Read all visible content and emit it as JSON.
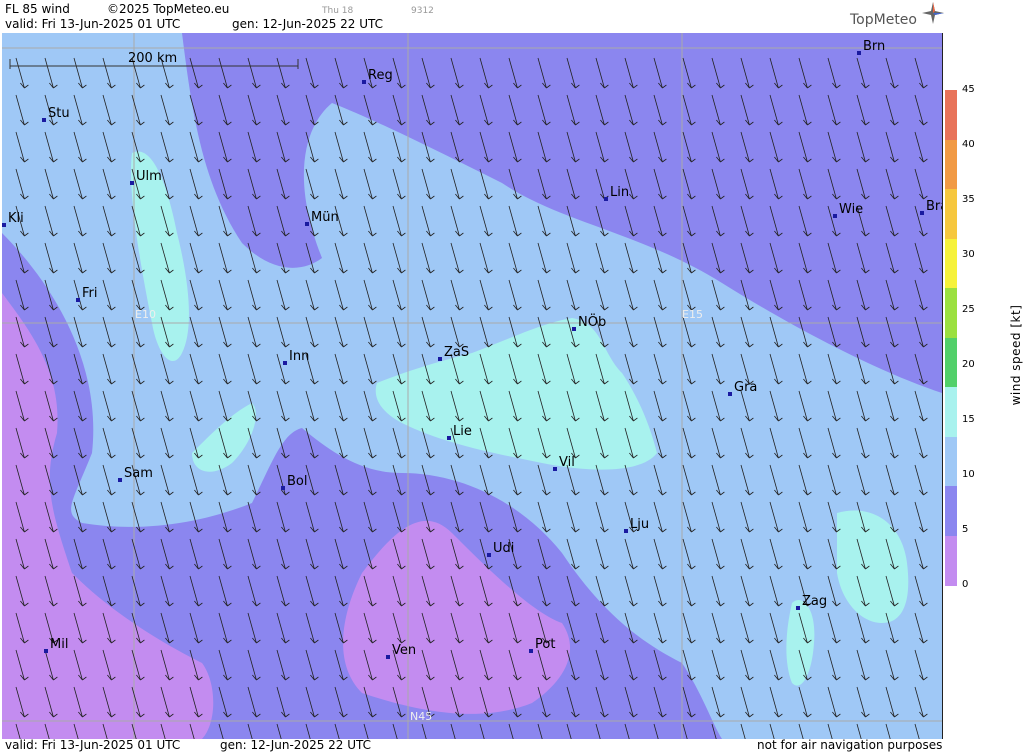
{
  "header": {
    "product": "FL 85 wind",
    "copyright": "©2025 TopMeteo.eu",
    "small_day": "Thu 18",
    "small_code": "9312",
    "valid": "valid:  Fri  13-Jun-2025  01 UTC",
    "gen": "gen: 12-Jun-2025 22 UTC",
    "brand": "TopMeteo"
  },
  "footer": {
    "valid": "valid:  Fri  13-Jun-2025  01 UTC",
    "gen": "gen: 12-Jun-2025 22 UTC",
    "disclaimer": "not for air navigation purposes"
  },
  "scale_bar": {
    "label": "200 km"
  },
  "grid_labels": {
    "e10": "E10",
    "e15": "E15",
    "n45": "N45"
  },
  "legend": {
    "label": "wind  speed  [kt]",
    "ticks": [
      "45",
      "40",
      "35",
      "30",
      "25",
      "20",
      "15",
      "10",
      "5",
      "0"
    ],
    "colors": [
      "#e8735a",
      "#f19a45",
      "#f6c73e",
      "#f6f23a",
      "#9be040",
      "#52d06a",
      "#a8f2ee",
      "#9fc8f6",
      "#8b86ef",
      "#c38cf0"
    ]
  },
  "cities": [
    {
      "name": "Stu"
    },
    {
      "name": "Reg"
    },
    {
      "name": "Brn"
    },
    {
      "name": "Ulm"
    },
    {
      "name": "Kli"
    },
    {
      "name": "Mün"
    },
    {
      "name": "Lin"
    },
    {
      "name": "Wie"
    },
    {
      "name": "Bra"
    },
    {
      "name": "Fri"
    },
    {
      "name": "NÖb"
    },
    {
      "name": "Inn"
    },
    {
      "name": "ZaS"
    },
    {
      "name": "Gra"
    },
    {
      "name": "Lie"
    },
    {
      "name": "Vil"
    },
    {
      "name": "Sam"
    },
    {
      "name": "Bol"
    },
    {
      "name": "Lju"
    },
    {
      "name": "Udi"
    },
    {
      "name": "Zag"
    },
    {
      "name": "Mil"
    },
    {
      "name": "Ven"
    },
    {
      "name": "Pot"
    }
  ]
}
